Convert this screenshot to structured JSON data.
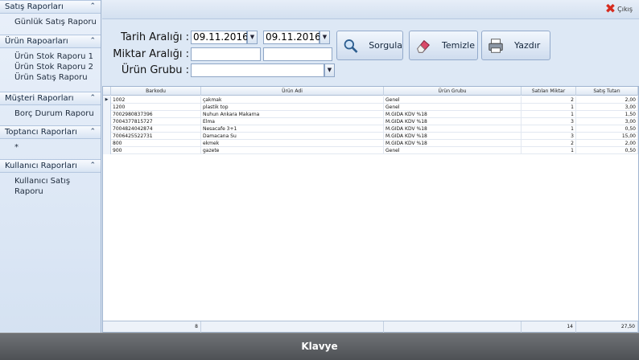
{
  "sidebar": {
    "groups": [
      {
        "title": "Satış Raporları",
        "items": [
          "Günlük Satış Raporu"
        ]
      },
      {
        "title": "Ürün Rapoarları",
        "items": [
          "Ürün Stok Raporu 1",
          "Ürün Stok Raporu 2",
          "Ürün Satış Raporu"
        ]
      },
      {
        "title": "Müşteri Raporları",
        "items": [
          "Borç Durum Raporu"
        ]
      },
      {
        "title": "Toptancı Raporları",
        "items": [
          "*"
        ]
      },
      {
        "title": "Kullanıcı Raporları",
        "items": [
          "Kullanıcı Satış Raporu"
        ]
      }
    ]
  },
  "topbar": {
    "exit_label": "Çıkış"
  },
  "filters": {
    "date_label": "Tarih Aralığı :",
    "date_from": "09.11.2016",
    "date_to": "09.11.2016",
    "amount_label": "Miktar Aralığı :",
    "amount_from": "",
    "amount_to": "",
    "group_label": "Ürün Grubu :",
    "group_value": ""
  },
  "buttons": {
    "query": "Sorgula",
    "clear": "Temizle",
    "print": "Yazdır"
  },
  "grid": {
    "columns": [
      "Barkodu",
      "Ürün Adi",
      "Ürün Grubu",
      "Satılan Miktar",
      "Satış Tutarı"
    ],
    "rows": [
      [
        "1002",
        "çakmak",
        "Genel",
        "2",
        "2,00"
      ],
      [
        "1200",
        "plastik top",
        "Genel",
        "1",
        "3,00"
      ],
      [
        "7002980837396",
        "Nuhun Ankara Makarna",
        "M.GIDA KDV %18",
        "1",
        "1,50"
      ],
      [
        "7004377815727",
        "Elma",
        "M.GIDA KDV %18",
        "3",
        "3,00"
      ],
      [
        "7004824042874",
        "Nesacafe 3+1",
        "M.GIDA KDV %18",
        "1",
        "0,50"
      ],
      [
        "7006425522731",
        "Damacana Su",
        "M.GIDA KDV %18",
        "3",
        "15,00"
      ],
      [
        "800",
        "ekmek",
        "M.GIDA KDV %18",
        "2",
        "2,00"
      ],
      [
        "900",
        "gazete",
        "Genel",
        "1",
        "0,50"
      ]
    ],
    "footer": {
      "count": "8",
      "total_qty": "14",
      "total_amount": "27,50"
    }
  },
  "keyboard": {
    "label": "Klavye"
  },
  "colors": {
    "exit_icon": "#d62c1f",
    "accent": "#dce6f2"
  }
}
